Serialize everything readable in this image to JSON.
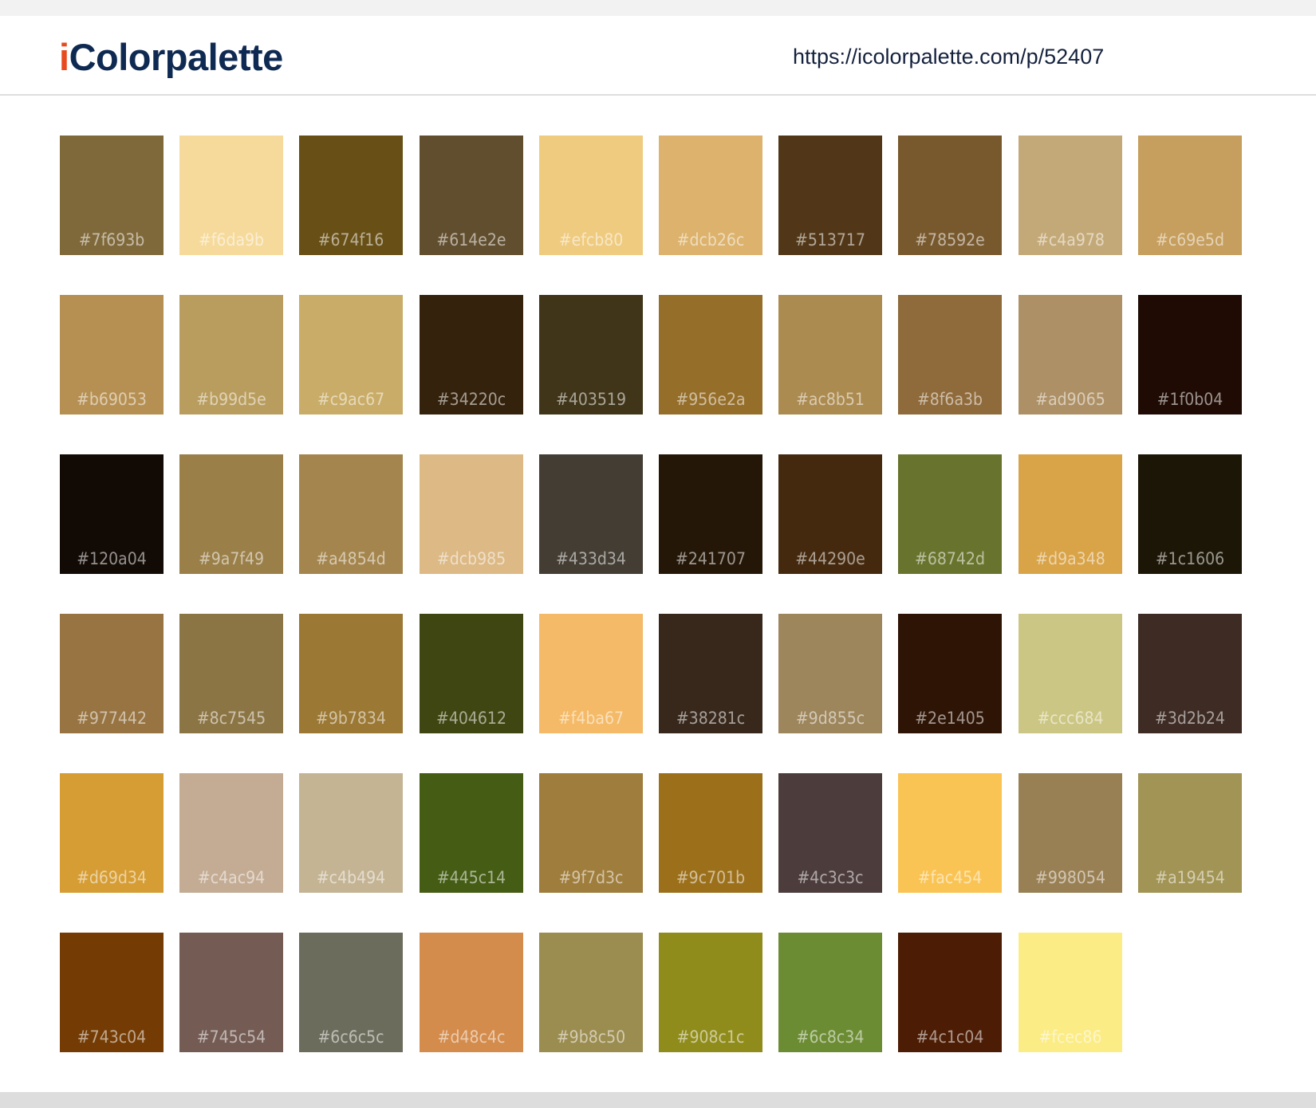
{
  "header": {
    "logo_i": "i",
    "logo_rest": "Colorpalette",
    "url": "https://icolorpalette.com/p/52407"
  },
  "colors": {
    "logo_navy": "#0f2a52",
    "logo_accent": "#e84a1f",
    "page_background": "#ffffff",
    "top_strip": "#f2f2f2",
    "bottom_strip": "#dddddd"
  },
  "palette": [
    "#7f693b",
    "#f6da9b",
    "#674f16",
    "#614e2e",
    "#efcb80",
    "#dcb26c",
    "#513717",
    "#78592e",
    "#c4a978",
    "#c69e5d",
    "#b69053",
    "#b99d5e",
    "#c9ac67",
    "#34220c",
    "#403519",
    "#956e2a",
    "#ac8b51",
    "#8f6a3b",
    "#ad9065",
    "#1f0b04",
    "#120a04",
    "#9a7f49",
    "#a4854d",
    "#dcb985",
    "#433d34",
    "#241707",
    "#44290e",
    "#68742d",
    "#d9a348",
    "#1c1606",
    "#977442",
    "#8c7545",
    "#9b7834",
    "#404612",
    "#f4ba67",
    "#38281c",
    "#9d855c",
    "#2e1405",
    "#ccc684",
    "#3d2b24",
    "#d69d34",
    "#c4ac94",
    "#c4b494",
    "#445c14",
    "#9f7d3c",
    "#9c701b",
    "#4c3c3c",
    "#fac454",
    "#998054",
    "#a19454",
    "#743c04",
    "#745c54",
    "#6c6c5c",
    "#d48c4c",
    "#9b8c50",
    "#908c1c",
    "#6c8c34",
    "#4c1c04",
    "#fcec86"
  ]
}
